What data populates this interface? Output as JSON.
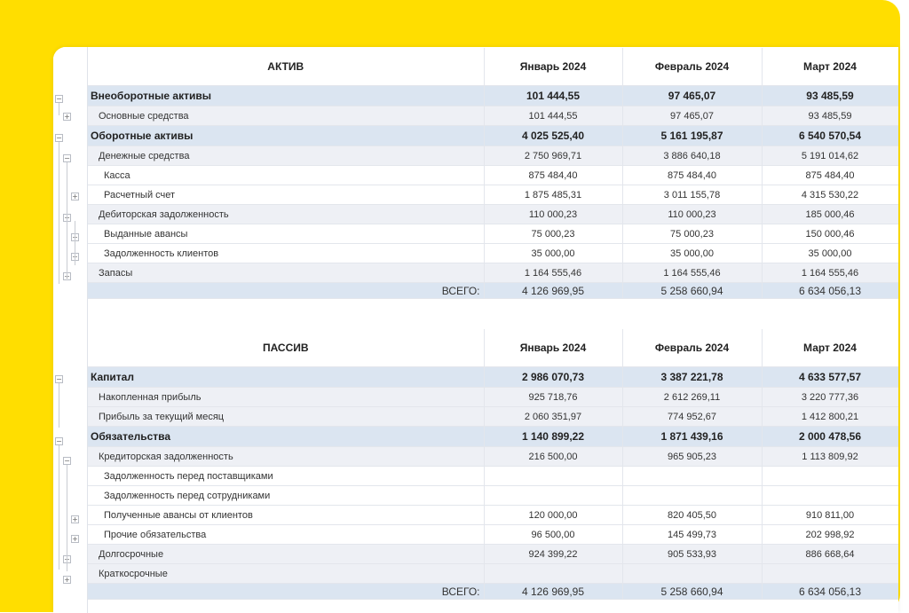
{
  "colors": {
    "yellow": "#ffde00",
    "group_row": "#dbe5f1",
    "sub_row": "#eef0f5"
  },
  "icons": {
    "expand": "plus-box-icon",
    "collapse": "minus-box-icon"
  },
  "months": [
    "Январь 2024",
    "Февраль 2024",
    "Март 2024"
  ],
  "assets": {
    "header": "АКТИВ",
    "rows": [
      {
        "kind": "grp",
        "name": "Внеоборотные активы",
        "v": [
          "101 444,55",
          "97 465,07",
          "93 485,59"
        ]
      },
      {
        "kind": "sub",
        "name": "Основные средства",
        "v": [
          "101 444,55",
          "97 465,07",
          "93 485,59"
        ]
      },
      {
        "kind": "grp",
        "name": "Оборотные активы",
        "v": [
          "4 025 525,40",
          "5 161 195,87",
          "6 540 570,54"
        ]
      },
      {
        "kind": "sub",
        "name": "Денежные средства",
        "v": [
          "2 750 969,71",
          "3 886 640,18",
          "5 191 014,62"
        ]
      },
      {
        "kind": "leaf",
        "name": "Касса",
        "v": [
          "875 484,40",
          "875 484,40",
          "875 484,40"
        ]
      },
      {
        "kind": "leaf",
        "name": "Расчетный счет",
        "v": [
          "1 875 485,31",
          "3 011 155,78",
          "4 315 530,22"
        ]
      },
      {
        "kind": "sub",
        "name": "Дебиторская задолженность",
        "v": [
          "110 000,23",
          "110 000,23",
          "185 000,46"
        ]
      },
      {
        "kind": "leaf",
        "name": "Выданные авансы",
        "v": [
          "75 000,23",
          "75 000,23",
          "150 000,46"
        ]
      },
      {
        "kind": "leaf",
        "name": "Задолженность клиентов",
        "v": [
          "35 000,00",
          "35 000,00",
          "35 000,00"
        ]
      },
      {
        "kind": "sub",
        "name": "Запасы",
        "v": [
          "1 164 555,46",
          "1 164 555,46",
          "1 164 555,46"
        ]
      }
    ],
    "total_label": "ВСЕГО:",
    "total": [
      "4 126 969,95",
      "5 258 660,94",
      "6 634 056,13"
    ]
  },
  "liabilities": {
    "header": "ПАССИВ",
    "rows": [
      {
        "kind": "grp",
        "name": "Капитал",
        "v": [
          "2 986 070,73",
          "3 387 221,78",
          "4 633 577,57"
        ]
      },
      {
        "kind": "sub",
        "name": "Накопленная прибыль",
        "v": [
          "925 718,76",
          "2 612 269,11",
          "3 220 777,36"
        ]
      },
      {
        "kind": "sub",
        "name": "Прибыль за текущий месяц",
        "v": [
          "2 060 351,97",
          "774 952,67",
          "1 412 800,21"
        ]
      },
      {
        "kind": "grp",
        "name": "Обязательства",
        "v": [
          "1 140 899,22",
          "1 871 439,16",
          "2 000 478,56"
        ]
      },
      {
        "kind": "sub",
        "name": "Кредиторская задолженность",
        "v": [
          "216 500,00",
          "965 905,23",
          "1 113 809,92"
        ]
      },
      {
        "kind": "leaf",
        "name": "Задолженность перед поставщиками",
        "v": [
          "",
          "",
          ""
        ]
      },
      {
        "kind": "leaf",
        "name": "Задолженность перед сотрудниками",
        "v": [
          "",
          "",
          ""
        ]
      },
      {
        "kind": "leaf",
        "name": "Полученные авансы от клиентов",
        "v": [
          "120 000,00",
          "820 405,50",
          "910 811,00"
        ]
      },
      {
        "kind": "leaf",
        "name": "Прочие обязательства",
        "v": [
          "96 500,00",
          "145 499,73",
          "202 998,92"
        ]
      },
      {
        "kind": "sub",
        "name": "Долгосрочные",
        "v": [
          "924 399,22",
          "905 533,93",
          "886 668,64"
        ]
      },
      {
        "kind": "sub",
        "name": "Краткосрочные",
        "v": [
          "",
          "",
          ""
        ]
      }
    ],
    "total_label": "ВСЕГО:",
    "total": [
      "4 126 969,95",
      "5 258 660,94",
      "6 634 056,13"
    ]
  }
}
